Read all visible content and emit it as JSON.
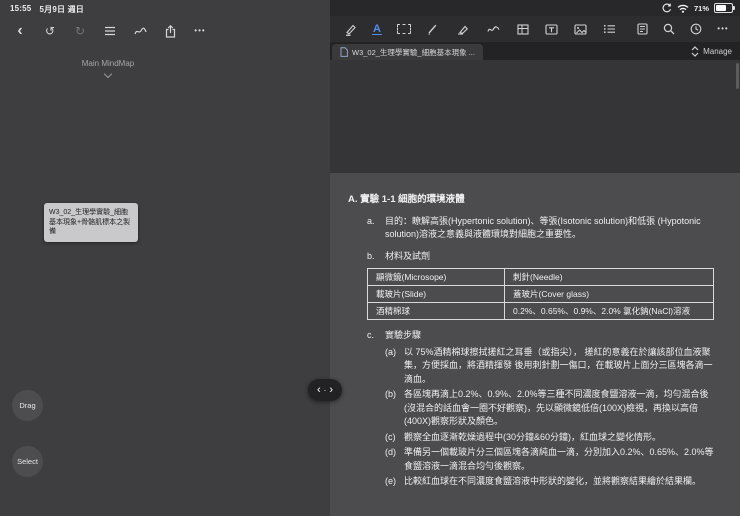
{
  "status_bar": {
    "time": "15:55",
    "date": "5月9日 週日",
    "battery_percent": "71%",
    "icon_names": [
      "rotation-lock-icon",
      "wifi-icon",
      "battery-icon"
    ]
  },
  "glyphs": {
    "back": "‹",
    "undo": "↺",
    "redo": "↻",
    "more": "•••",
    "text_tool": "A",
    "nav_left": "‹",
    "nav_dot": "·",
    "nav_right": "›"
  },
  "mindmap_panel": {
    "toolbar_icon_names": [
      "back-icon",
      "undo-icon",
      "redo-icon",
      "list-icon",
      "pen-squiggle-icon",
      "share-icon",
      "more-icon"
    ],
    "title": "Main MindMap",
    "node_text": "W3_02_生理學實驗_細胞基本現象+骨骼肌標本之製備",
    "drag_label": "Drag",
    "select_label": "Select"
  },
  "document_panel": {
    "toolbar_icon_names": [
      "highlighter-tool-icon",
      "text-excerpt-tool-icon",
      "rect-excerpt-tool-icon",
      "pen-tool-icon",
      "eraser-tool-icon",
      "freehand-tool-icon",
      "frame-tool-icon",
      "textbox-tool-icon",
      "image-tool-icon",
      "outline-tool-icon",
      "document-sidebar-icon",
      "search-icon",
      "history-icon",
      "more-icon"
    ],
    "tab_title": "W3_02_生理學實驗_細胞基本現象 ...",
    "manage_label": "Manage",
    "page": {
      "section_title": "A. 實驗 1-1 細胞的環境液體",
      "items": [
        {
          "label": "a.",
          "text": "目的：瞭解高張(Hypertonic solution)、等張(Isotonic solution)和低張 (Hypotonic solution)溶液之意義與液體環境對細胞之重要性。"
        },
        {
          "label": "b.",
          "text": "材料及試劑"
        }
      ],
      "materials_table": {
        "rows": [
          [
            "顯微鏡(Microsope)",
            "刺針(Needle)"
          ],
          [
            "載玻片(Slide)",
            "蓋玻片(Cover glass)"
          ],
          [
            "酒精棉球",
            "0.2%、0.65%、0.9%、2.0% 氯化鈉(NaCl)溶液"
          ]
        ]
      },
      "steps_head": {
        "label": "c.",
        "text": "實驗步驟"
      },
      "steps": [
        {
          "label": "(a)",
          "text": "以 75%酒精棉球擦拭搓紅之耳垂（或指尖）， 搓紅的意義在於讓該部位血液聚集，方便採血，將酒精揮發 後用刺針劃一傷口，在載玻片上面分三區塊各滴一滴血。"
        },
        {
          "label": "(b)",
          "text": "各區塊再滴上0.2%、0.9%、2.0%等三種不同濃度食鹽溶液一滴，均勻混合後(沒混合的話血會一圈不好觀察)，先以顯微鏡低倍(100X)檢視，再換以高倍(400X)觀察形狀及顏色。"
        },
        {
          "label": "(c)",
          "text": "觀察全血逐漸乾燥過程中(30分鐘&60分鐘)，紅血球之變化情形。"
        },
        {
          "label": "(d)",
          "text": "準備另一個載玻片分三個區塊各滴純血一滴，分別加入0.2%、0.65%、2.0%等食鹽溶液一滴混合均勻後觀察。"
        },
        {
          "label": "(e)",
          "text": "比較紅血球在不同濃度食鹽溶液中形狀的變化，並將觀察結果繪於結果欄。"
        }
      ]
    },
    "colors": {
      "active_tool": "#4e8df2",
      "page_background": "#4c4c4e",
      "panel_background": "#28282a"
    }
  }
}
